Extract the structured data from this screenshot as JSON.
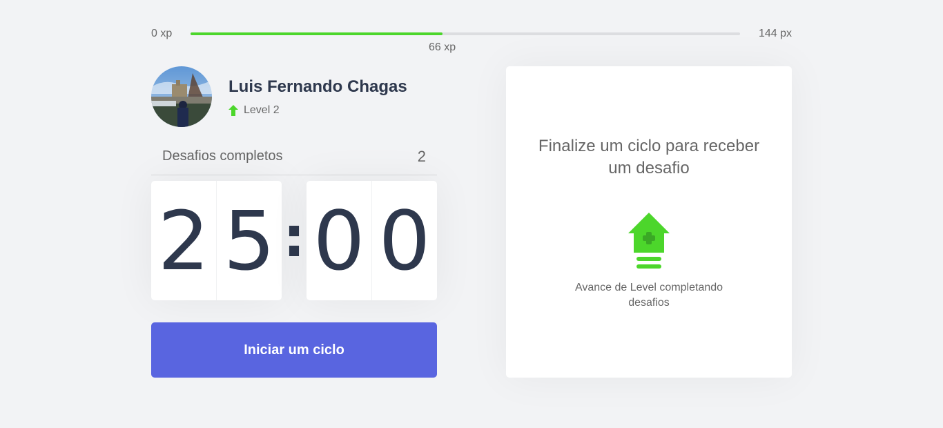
{
  "experience": {
    "min_label": "0 xp",
    "max_label": "144 px",
    "current_label": "66 xp",
    "current_value": 66,
    "max_value": 144,
    "progress_fraction": 0.458,
    "bar_color": "#4cd62b"
  },
  "profile": {
    "name": "Luis Fernando Chagas",
    "level_label": "Level 2",
    "level_icon": "level-up-arrow-icon"
  },
  "completed_challenges": {
    "label": "Desafios completos",
    "count": "2"
  },
  "countdown": {
    "minute_left": "2",
    "minute_right": "5",
    "separator": ":",
    "second_left": "0",
    "second_right": "0"
  },
  "start_button": {
    "label": "Iniciar um ciclo",
    "color": "#5965e0"
  },
  "challenge_box": {
    "title": "Finalize um ciclo para receber um desafio",
    "icon": "level-up-icon",
    "hint": "Avance de Level completando desafios"
  },
  "colors": {
    "background": "#f2f3f5",
    "green": "#4cd62b",
    "title_text": "#2e384d",
    "body_text": "#666666"
  }
}
